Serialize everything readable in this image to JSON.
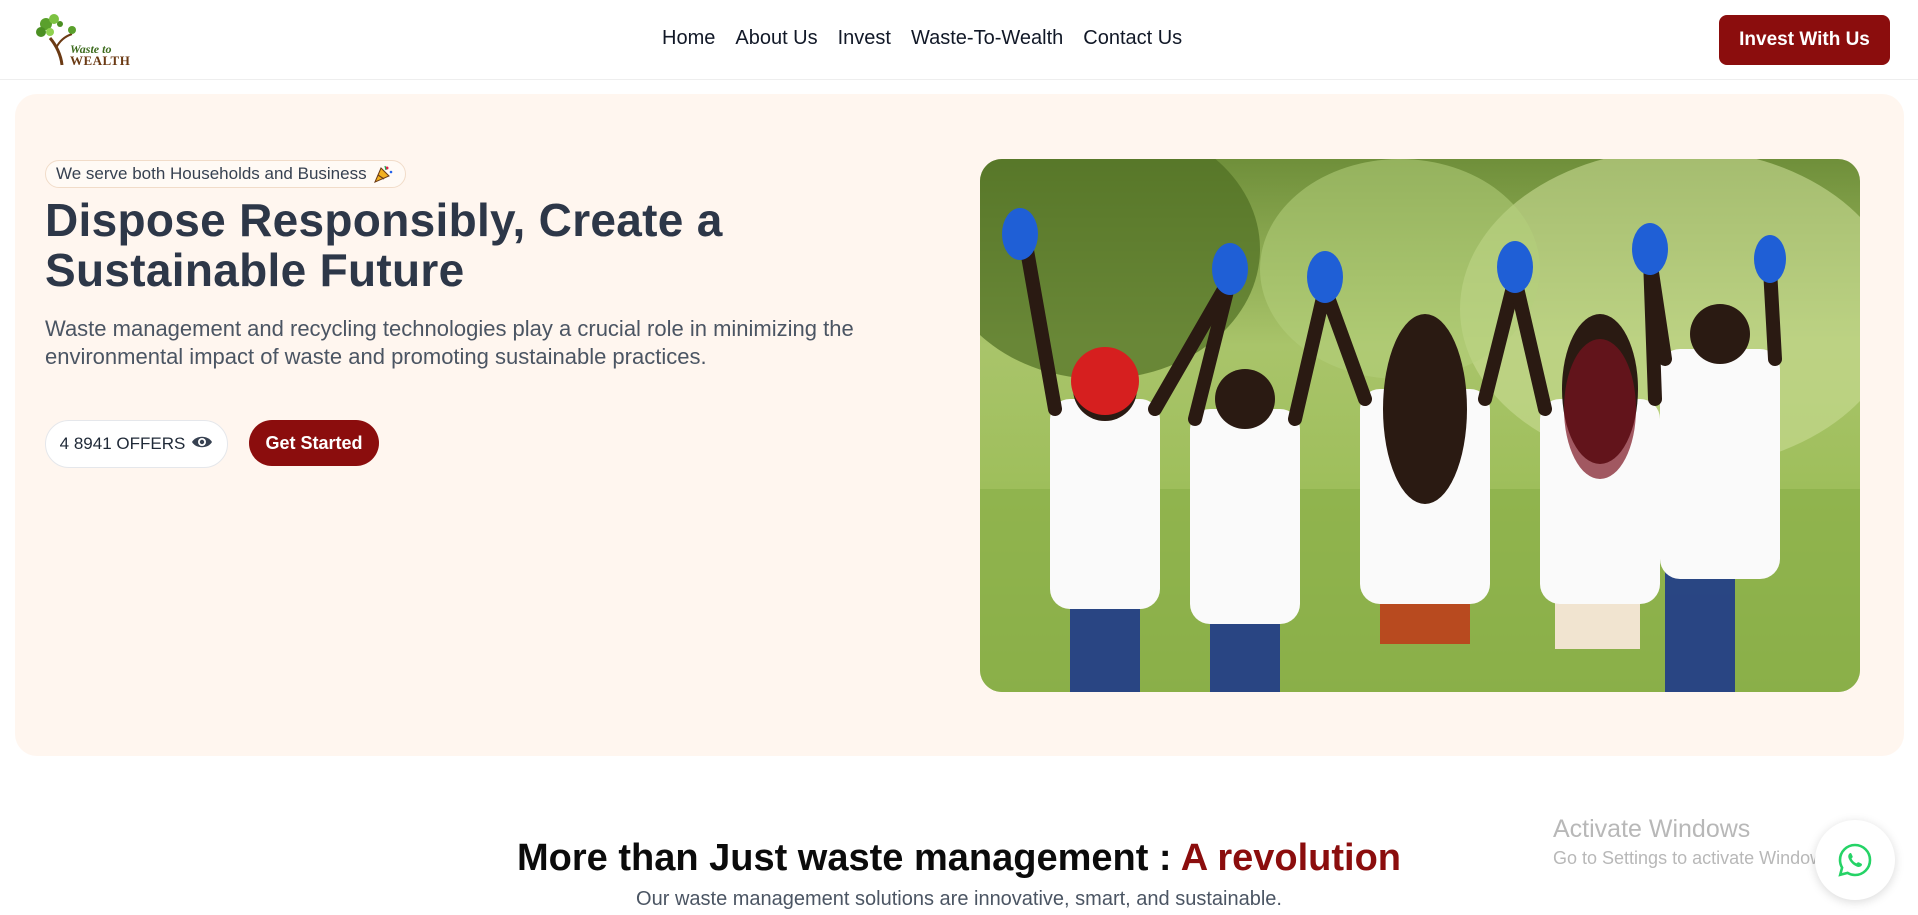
{
  "brand": {
    "logo_line1": "Waste to",
    "logo_line2": "WEALTH"
  },
  "nav": {
    "links": [
      {
        "label": "Home"
      },
      {
        "label": "About Us"
      },
      {
        "label": "Invest"
      },
      {
        "label": "Waste-To-Wealth"
      },
      {
        "label": "Contact Us"
      }
    ],
    "cta_label": "Invest With Us"
  },
  "hero": {
    "tag": "We serve both Households and Business",
    "tag_icon": "party-popper-icon",
    "title": "Dispose Responsibly, Create a Sustainable Future",
    "subtitle": "Waste management and recycling technologies play a crucial role in minimizing the environmental impact of waste and promoting sustainable practices.",
    "offers_label": "4 8941 OFFERS",
    "offers_icon": "eye-icon",
    "cta_label": "Get Started",
    "image": "volunteers-raising-joined-hands-photo"
  },
  "section": {
    "title_main": "More than Just waste management : ",
    "title_accent": "A revolution",
    "subtitle": "Our waste management solutions are innovative, smart, and sustainable."
  },
  "watermark": {
    "line1": "Activate Windows",
    "line2": "Go to Settings to activate Windows."
  },
  "colors": {
    "brand_red": "#8b0d0d",
    "hero_bg": "#fff6ef",
    "whatsapp_green": "#25d366"
  }
}
